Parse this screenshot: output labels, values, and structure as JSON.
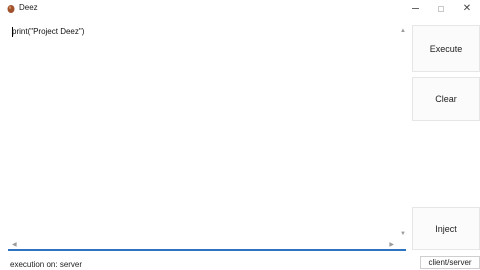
{
  "window": {
    "title": "Deez",
    "minimize_icon": "minimize-icon",
    "maximize_icon": "maximize-icon",
    "close_glyph": "✕"
  },
  "editor": {
    "content": "print(\"Project Deez\")",
    "scroll_up_glyph": "▲",
    "scroll_down_glyph": "▼",
    "scroll_left_glyph": "◀",
    "scroll_right_glyph": "▶",
    "accent_color": "#2f74c0"
  },
  "buttons": {
    "execute_label": "Execute",
    "clear_label": "Clear",
    "inject_label": "Inject"
  },
  "status": {
    "execution_text": "execution on: server",
    "mode_toggle_label": "client/server"
  }
}
